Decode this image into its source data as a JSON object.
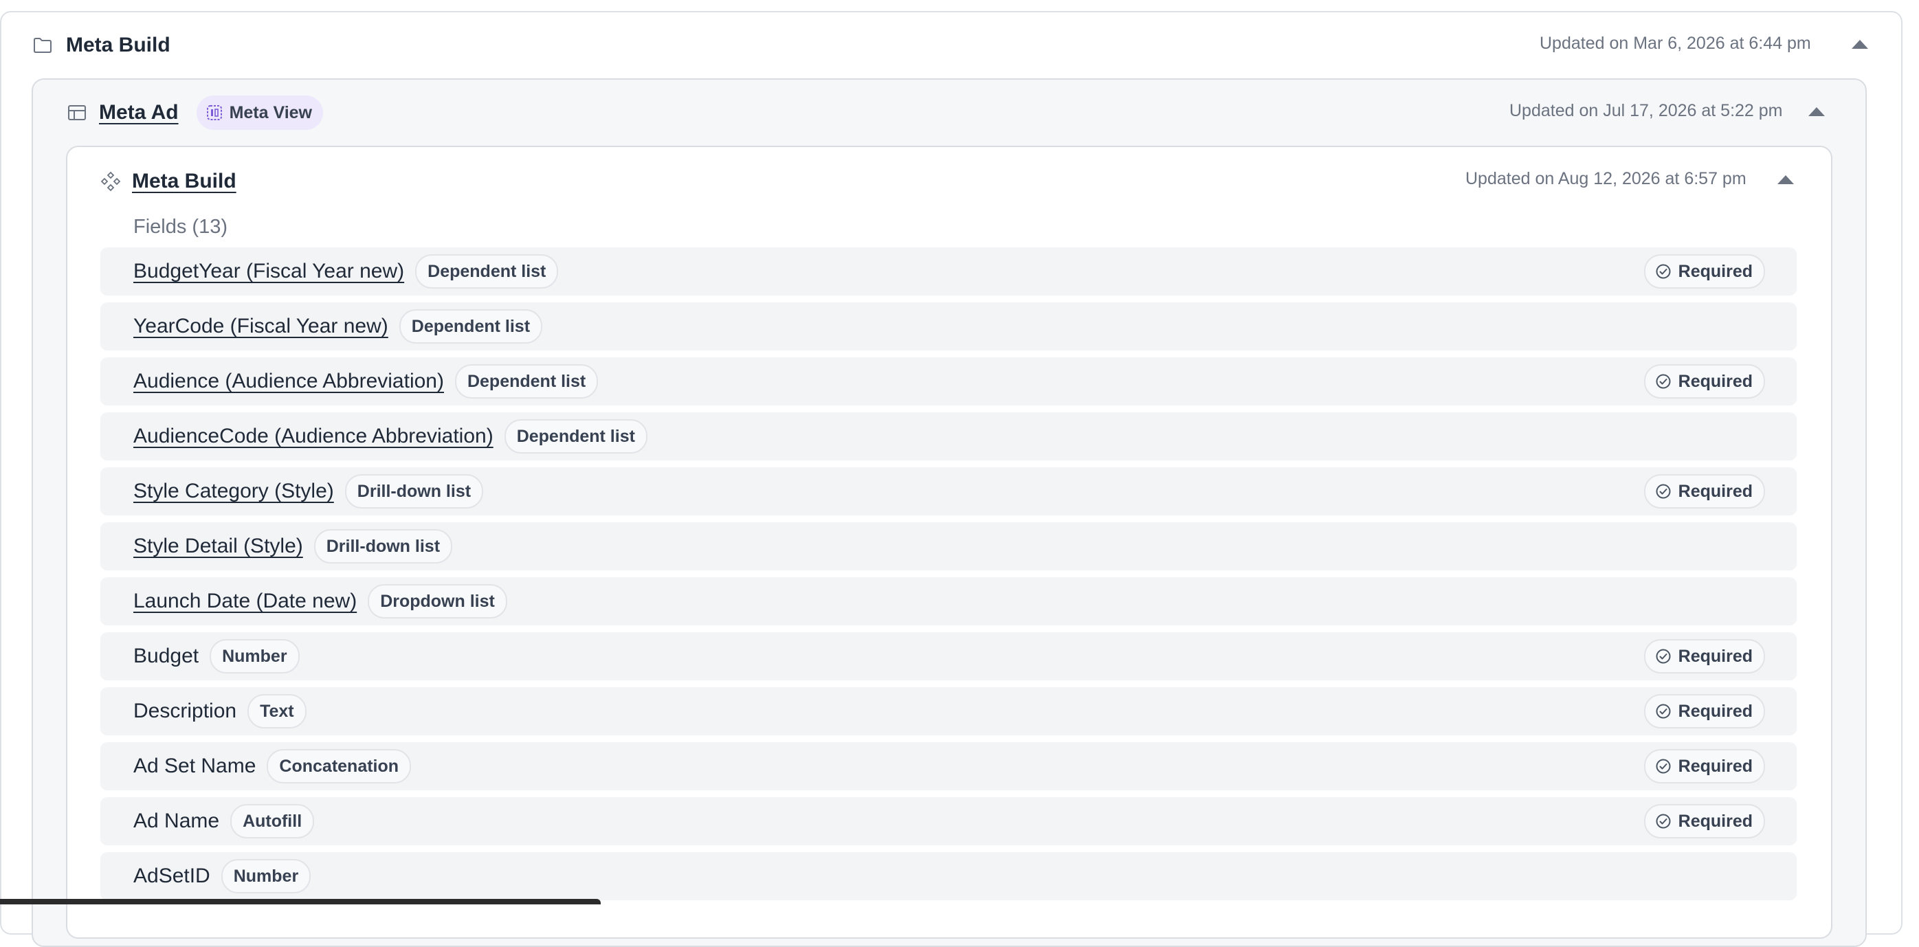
{
  "level1": {
    "title": "Meta Build",
    "updated": "Updated on Mar 6, 2026 at 6:44 pm",
    "icon": "folder-icon"
  },
  "level2": {
    "title": "Meta Ad",
    "badge": "Meta View",
    "updated": "Updated on Jul 17, 2026 at 5:22 pm",
    "icon": "table-icon",
    "badge_icon": "view-icon"
  },
  "level3": {
    "title": "Meta Build",
    "updated": "Updated on Aug 12, 2026 at 6:57 pm",
    "icon": "component-icon",
    "fields_label": "Fields (13)"
  },
  "required_label": "Required",
  "fields": [
    {
      "name": "BudgetYear (Fiscal Year new)",
      "type": "Dependent list",
      "required": true,
      "link": true
    },
    {
      "name": "YearCode (Fiscal Year new)",
      "type": "Dependent list",
      "required": false,
      "link": true
    },
    {
      "name": "Audience (Audience Abbreviation)",
      "type": "Dependent list",
      "required": true,
      "link": true
    },
    {
      "name": "AudienceCode (Audience Abbreviation)",
      "type": "Dependent list",
      "required": false,
      "link": true
    },
    {
      "name": "Style Category (Style)",
      "type": "Drill-down list",
      "required": true,
      "link": true
    },
    {
      "name": "Style Detail (Style)",
      "type": "Drill-down list",
      "required": false,
      "link": true
    },
    {
      "name": "Launch Date (Date new)",
      "type": "Dropdown list",
      "required": false,
      "link": true
    },
    {
      "name": "Budget",
      "type": "Number",
      "required": true,
      "link": false
    },
    {
      "name": "Description",
      "type": "Text",
      "required": true,
      "link": false
    },
    {
      "name": "Ad Set Name",
      "type": "Concatenation",
      "required": true,
      "link": false
    },
    {
      "name": "Ad Name",
      "type": "Autofill",
      "required": true,
      "link": false
    },
    {
      "name": "AdSetID",
      "type": "Number",
      "required": false,
      "link": false
    }
  ],
  "colors": {
    "text": "#1f2937",
    "muted": "#6b7280",
    "view_badge_bg": "#ede8fb",
    "view_icon": "#7c5cd6",
    "row_bg": "#f3f4f6"
  }
}
